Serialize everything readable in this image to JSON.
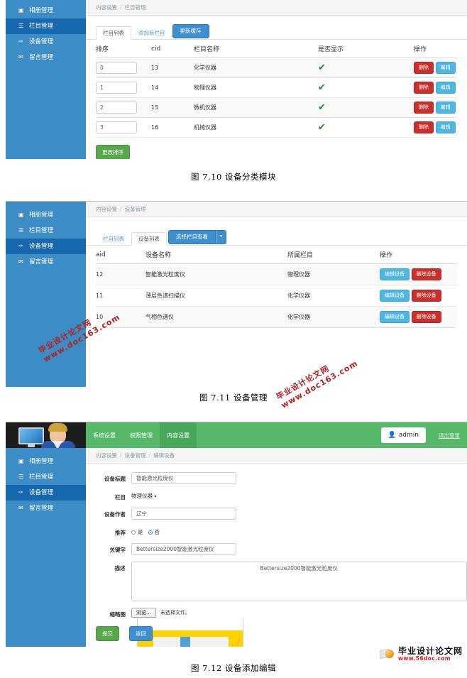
{
  "figures": [
    {
      "id": "fig-7-10",
      "caption": "图 7.10  设备分类模块",
      "sidebar": {
        "items": [
          {
            "icon": "image-icon",
            "label": "相册管理",
            "active": false
          },
          {
            "icon": "list-icon",
            "label": "栏目管理",
            "active": true
          },
          {
            "icon": "edit-icon",
            "label": "设备管理",
            "active": false
          },
          {
            "icon": "mail-icon",
            "label": "留言管理",
            "active": false
          }
        ]
      },
      "breadcrumb": [
        "内容设置",
        "栏目管理"
      ],
      "tabs": [
        {
          "label": "栏目列表",
          "style": "active"
        },
        {
          "label": "添加新栏目",
          "style": "plain"
        },
        {
          "label": "更新缓存",
          "style": "primary"
        }
      ],
      "table": {
        "headers": [
          "排序",
          "cid",
          "栏目名称",
          "是否显示",
          "操作"
        ],
        "rows": [
          {
            "order": "0",
            "cid": "13",
            "name": "化学仪器",
            "visible": "✔",
            "actions": [
              "删除",
              "编辑"
            ]
          },
          {
            "order": "1",
            "cid": "14",
            "name": "物理仪器",
            "visible": "✔",
            "actions": [
              "删除",
              "编辑"
            ]
          },
          {
            "order": "2",
            "cid": "15",
            "name": "微机仪器",
            "visible": "✔",
            "actions": [
              "删除",
              "编辑"
            ]
          },
          {
            "order": "3",
            "cid": "16",
            "name": "机械仪器",
            "visible": "✔",
            "actions": [
              "删除",
              "编辑"
            ]
          }
        ]
      },
      "submit_label": "更改排序"
    },
    {
      "id": "fig-7-11",
      "caption": "图 7.11  设备管理",
      "sidebar": {
        "items": [
          {
            "icon": "image-icon",
            "label": "相册管理",
            "active": false
          },
          {
            "icon": "list-icon",
            "label": "栏目管理",
            "active": false
          },
          {
            "icon": "edit-icon",
            "label": "设备管理",
            "active": true
          },
          {
            "icon": "mail-icon",
            "label": "留言管理",
            "active": false
          }
        ]
      },
      "breadcrumb": [
        "内容设置",
        "设备管理"
      ],
      "tabs": [
        {
          "label": "栏目列表",
          "style": "plain"
        },
        {
          "label": "设备列表",
          "style": "active"
        },
        {
          "label": "选择栏目查看",
          "style": "primary-split"
        }
      ],
      "table": {
        "headers": [
          "aid",
          "设备名称",
          "所属栏目",
          "操作"
        ],
        "rows": [
          {
            "aid": "12",
            "name": "智能激光粒度仪",
            "column": "物理仪器",
            "actions": [
              "编辑设备",
              "删除设备"
            ]
          },
          {
            "aid": "11",
            "name": "薄层色谱扫描仪",
            "column": "化学仪器",
            "actions": [
              "编辑设备",
              "删除设备"
            ]
          },
          {
            "aid": "10",
            "name": "气相色谱仪",
            "column": "化学仪器",
            "actions": [
              "编辑设备",
              "删除设备"
            ]
          }
        ]
      }
    },
    {
      "id": "fig-7-12",
      "caption": "图 7.12   设备添加编辑",
      "topnav": {
        "items": [
          {
            "label": "系统设置",
            "active": false
          },
          {
            "label": "权限管理",
            "active": false
          },
          {
            "label": "内容设置",
            "active": true
          }
        ],
        "user": "admin",
        "user_icon": "user-icon",
        "logout": "退出登录"
      },
      "sidebar": {
        "items": [
          {
            "icon": "image-icon",
            "label": "相册管理",
            "active": false
          },
          {
            "icon": "list-icon",
            "label": "栏目管理",
            "active": false
          },
          {
            "icon": "edit-icon",
            "label": "设备管理",
            "active": true
          },
          {
            "icon": "mail-icon",
            "label": "留言管理",
            "active": false
          }
        ]
      },
      "breadcrumb": [
        "内容设置",
        "设备管理",
        "编辑设备"
      ],
      "form": {
        "fields": [
          {
            "label": "设备标题",
            "type": "text",
            "value": "智能激光粒度仪"
          },
          {
            "label": "栏目",
            "type": "select",
            "value": "物理仪器"
          },
          {
            "label": "设备作者",
            "type": "text",
            "value": "辽宁"
          },
          {
            "label": "推荐",
            "type": "radio",
            "options": [
              "是",
              "否"
            ],
            "selected": "否"
          },
          {
            "label": "关键字",
            "type": "text",
            "value": "Bettersize2000智能激光粒度仪"
          },
          {
            "label": "描述",
            "type": "textarea",
            "value": "Bettersize2000智能激光粒度仪"
          },
          {
            "label": "缩略图",
            "type": "file",
            "button": "浏览…",
            "hint": "未选择文件。"
          }
        ],
        "submit_label": "提交",
        "back_label": "返回"
      }
    }
  ],
  "watermarks": [
    {
      "line1": "毕业设计论文网",
      "line2": "www.doc163.com"
    },
    {
      "line1": "毕业设计论文网",
      "line2": "www.doc163.com"
    }
  ],
  "footer_logo": {
    "title": "毕业设计论文网",
    "url": "www.56doc.com"
  },
  "colors": {
    "sidebar": "#3c8dc5",
    "sidebar_active": "#1667ad",
    "topbar": "#56b96a",
    "primary": "#3d8fd0",
    "danger": "#c9302c",
    "success": "#56a84b",
    "info": "#4fb6e0",
    "check": "#1f8a2e"
  }
}
